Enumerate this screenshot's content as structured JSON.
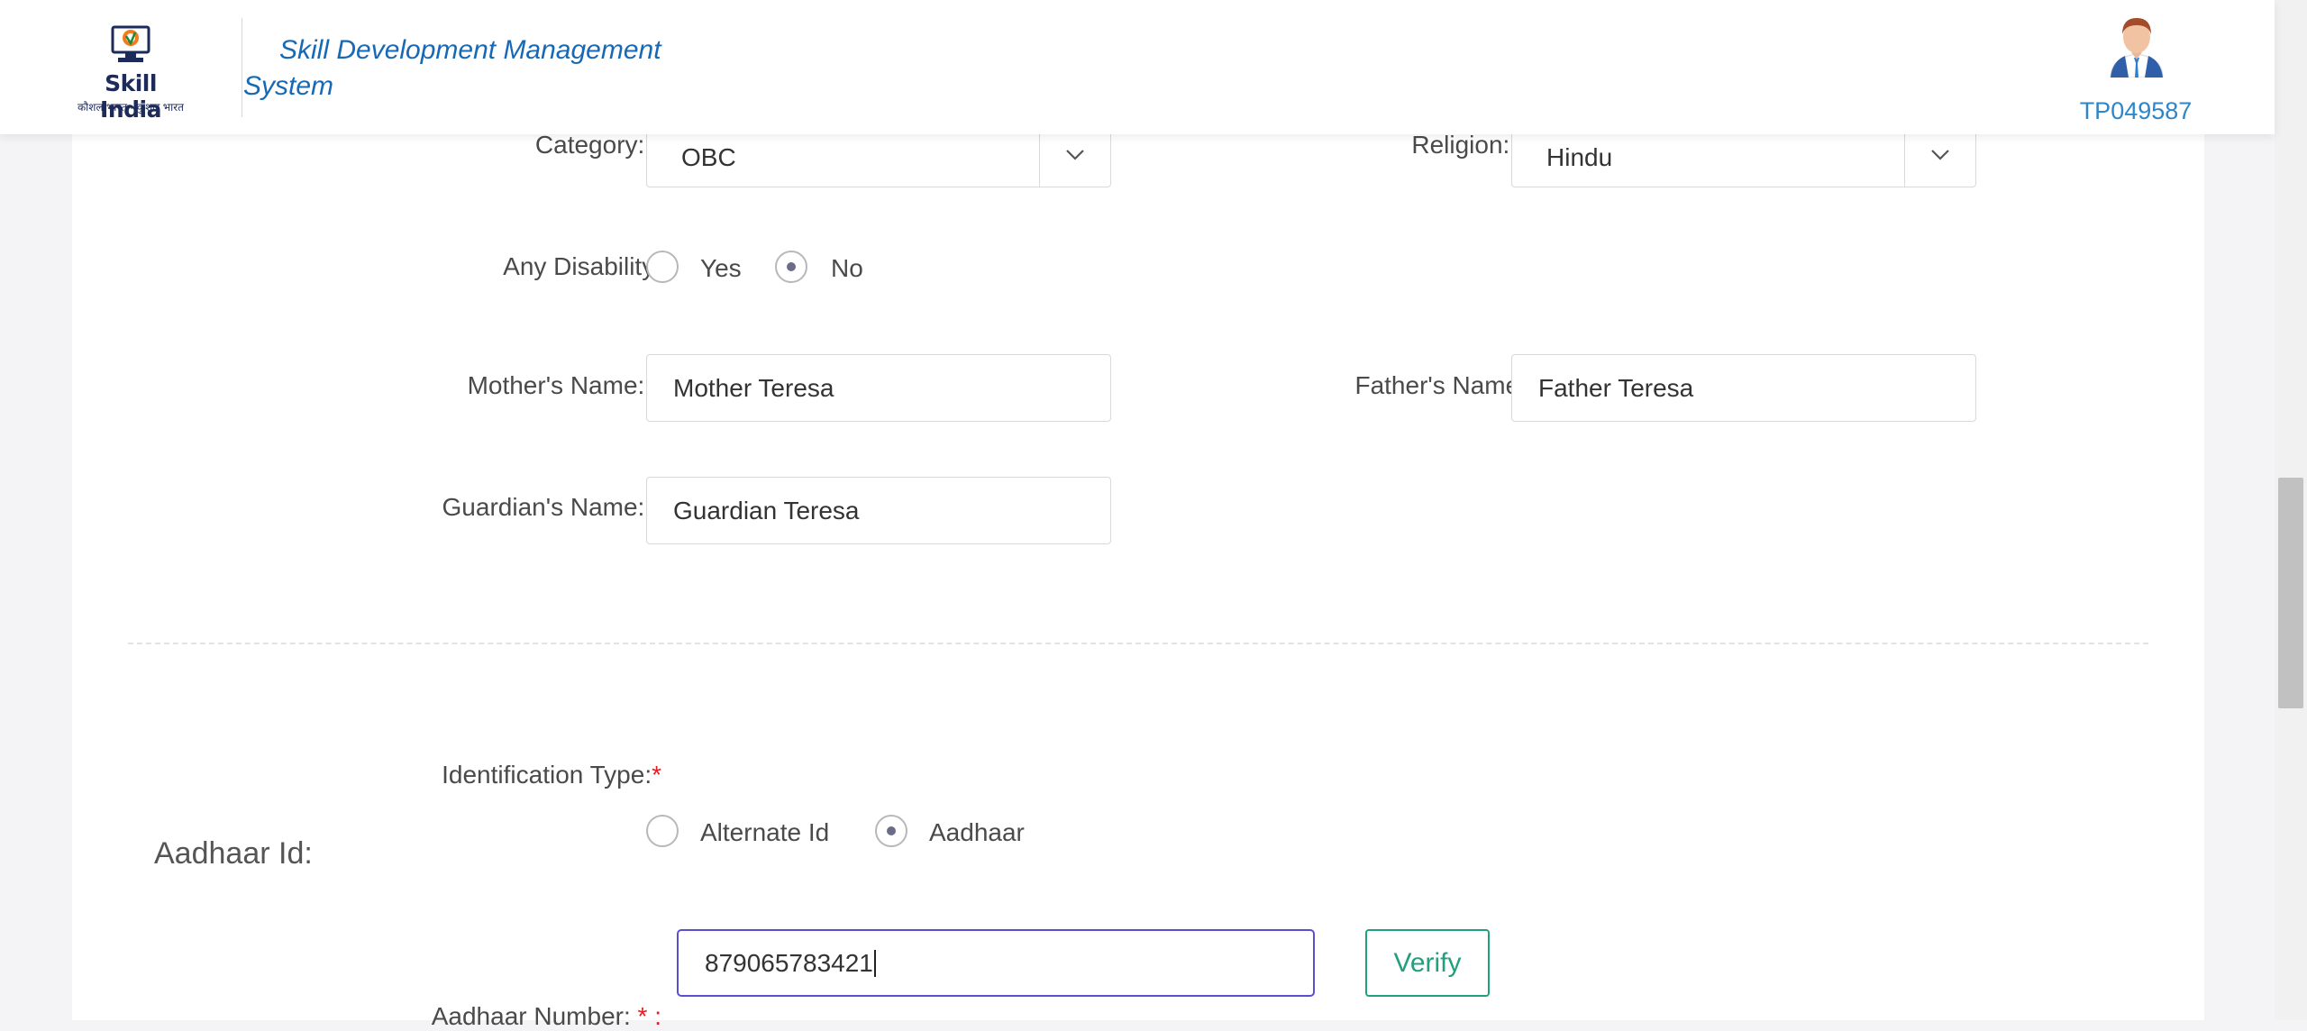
{
  "header": {
    "logo_name": "Skill India",
    "logo_tagline": "कौशल भारत - कुशल भारत",
    "app_title": "Skill Development Management System",
    "user_id": "TP049587"
  },
  "form": {
    "category": {
      "label": "Category:",
      "required": "*",
      "value": "OBC"
    },
    "religion": {
      "label": "Religion:",
      "required": "*",
      "value": "Hindu"
    },
    "disability": {
      "label": "Any Disability:",
      "options": [
        "Yes",
        "No"
      ],
      "selected": "No"
    },
    "mother_name": {
      "label": "Mother's Name:",
      "required": "*",
      "value": "Mother Teresa"
    },
    "father_name": {
      "label": "Father's Name:",
      "value": "Father Teresa"
    },
    "guardian_name": {
      "label": "Guardian's Name:",
      "required": "*",
      "value": "Guardian Teresa"
    },
    "identification_type": {
      "label": "Identification Type:",
      "required": "*",
      "options": [
        "Alternate Id",
        "Aadhaar"
      ],
      "selected": "Aadhaar"
    },
    "aadhaar_section_title": "Aadhaar Id:",
    "aadhaar_number": {
      "label": "Aadhaar Number:",
      "required": "*",
      "suffix": " :",
      "value": "879065783421"
    },
    "verify_label": "Verify"
  },
  "colors": {
    "brand_blue": "#1769b5",
    "required_red": "#e51c23",
    "verify_green": "#21a07e",
    "focus_border": "#5a4fcf"
  },
  "icons": [
    "skill-india-logo-icon",
    "user-avatar-icon",
    "chevron-down-icon"
  ]
}
